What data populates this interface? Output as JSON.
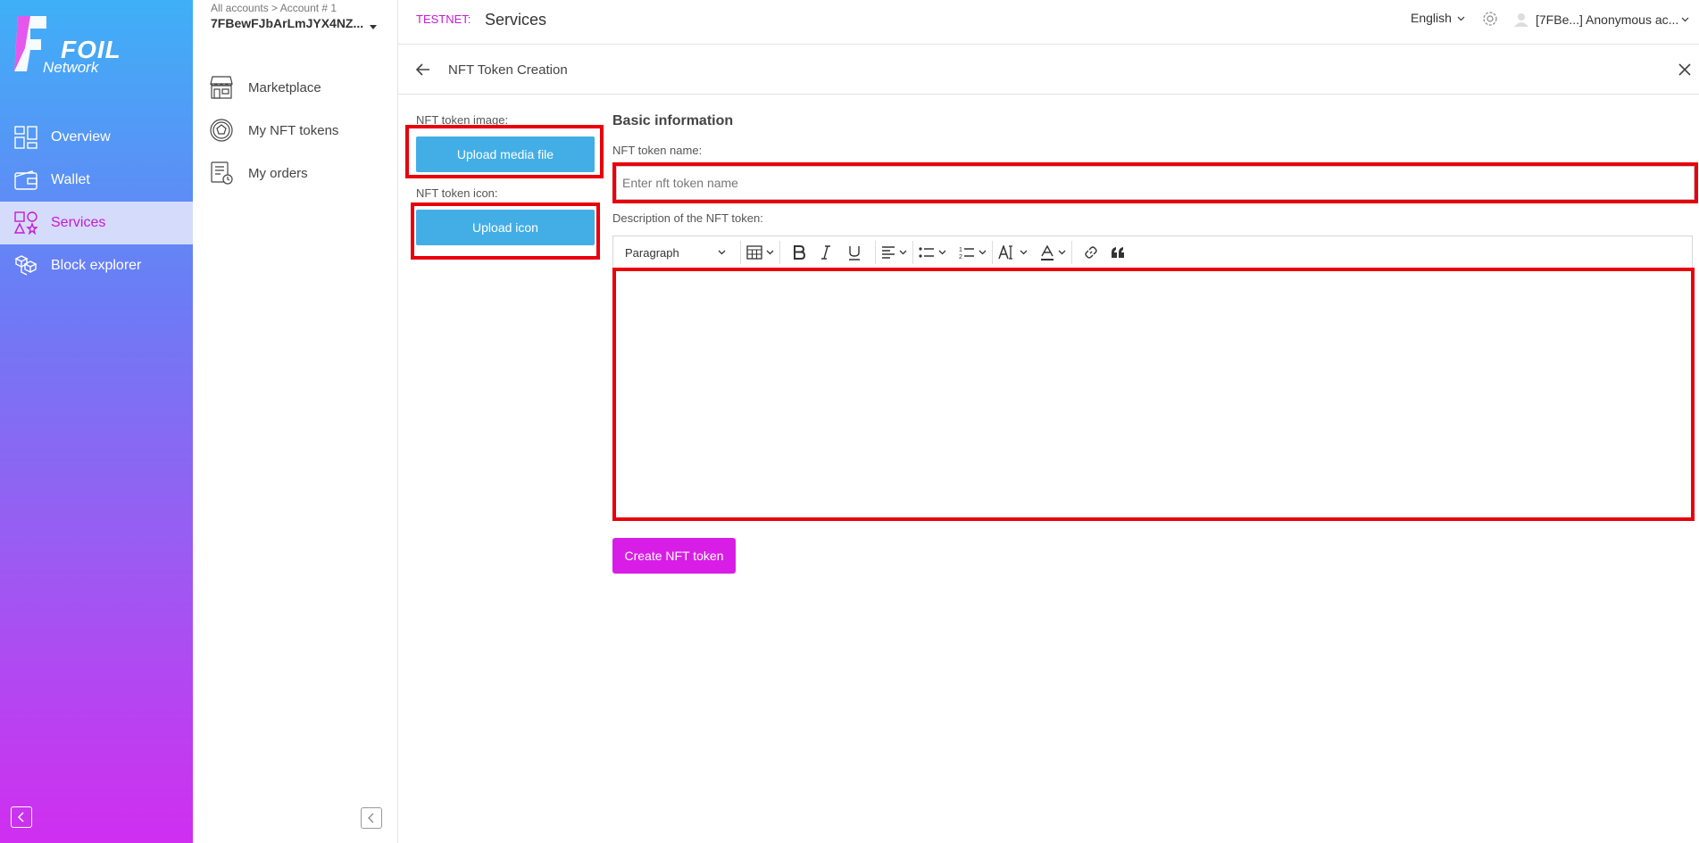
{
  "brand": {
    "logo_word1": "FOIL",
    "logo_word2": "Network"
  },
  "rail": {
    "items": [
      {
        "label": "Overview",
        "icon": "overview-icon"
      },
      {
        "label": "Wallet",
        "icon": "wallet-icon"
      },
      {
        "label": "Services",
        "icon": "services-icon",
        "active": true
      },
      {
        "label": "Block explorer",
        "icon": "blocks-icon"
      }
    ]
  },
  "account": {
    "breadcrumb": "All accounts > Account # 1",
    "id": "7FBewFJbArLmJYX4NZ..."
  },
  "sidebar": {
    "items": [
      {
        "label": "Marketplace",
        "icon": "store-icon"
      },
      {
        "label": "My NFT tokens",
        "icon": "token-icon"
      },
      {
        "label": "My orders",
        "icon": "orders-icon"
      }
    ]
  },
  "header": {
    "network": "TESTNET:",
    "section": "Services",
    "language": "English",
    "user": "[7FBe...] Anonymous ac..."
  },
  "page": {
    "title": "NFT Token Creation"
  },
  "media": {
    "image_label": "NFT token image:",
    "image_button": "Upload media file",
    "icon_label": "NFT token icon:",
    "icon_button": "Upload icon"
  },
  "form": {
    "section_title": "Basic information",
    "name_label": "NFT token name:",
    "name_placeholder": "Enter nft token name",
    "name_value": "",
    "description_label": "Description of the NFT token:",
    "toolbar": {
      "paragraph": "Paragraph"
    },
    "submit": "Create NFT token"
  },
  "colors": {
    "accent": "#d81ee6",
    "upload": "#43aee6",
    "highlight": "#e8000b"
  }
}
